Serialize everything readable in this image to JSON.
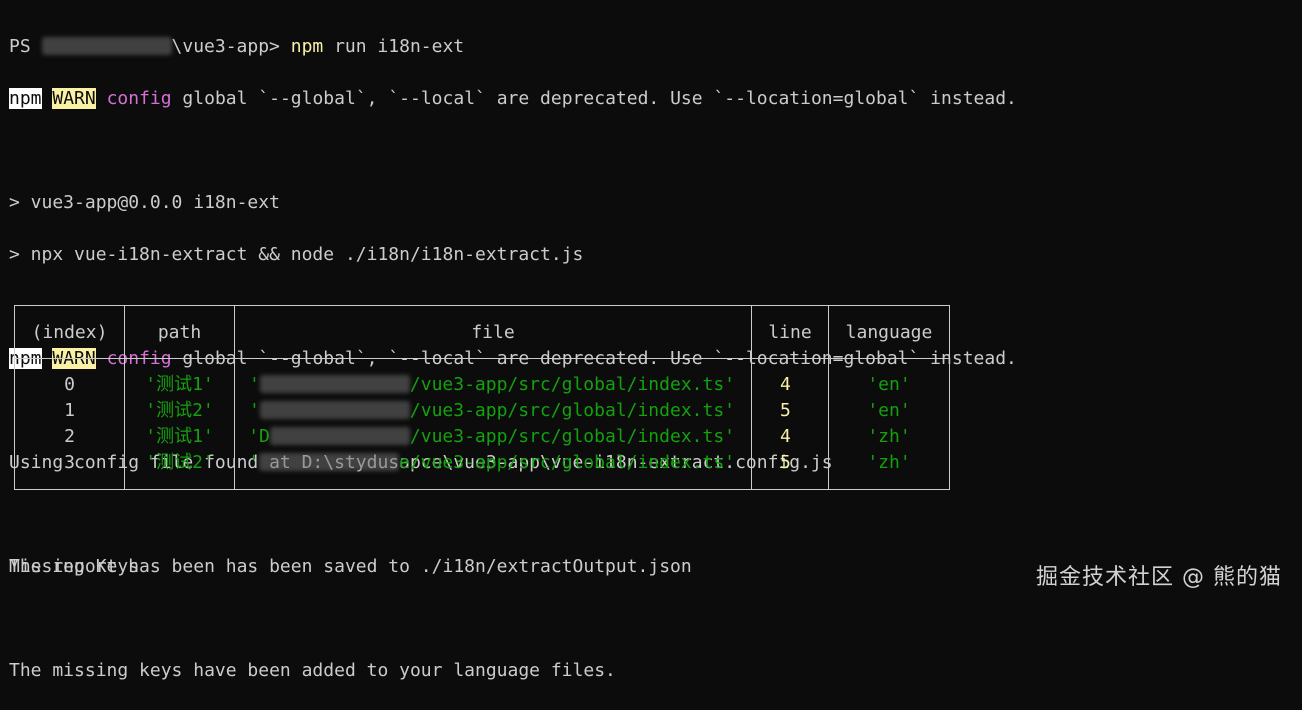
{
  "prompt": {
    "prefix": "PS ",
    "path_suffix": "\\vue3-app> ",
    "command_npm": "npm",
    "command_rest": " run i18n-ext"
  },
  "warn": {
    "npm": "npm",
    "warn": "WARN",
    "config": "config",
    "message": " global `--global`, `--local` are deprecated. Use `--location=global` instead."
  },
  "script_lines": [
    "> vue3-app@0.0.0 i18n-ext",
    "> npx vue-i18n-extract && node ./i18n/i18n-extract.js"
  ],
  "config_line": "Using config file found at D:\\stydusapce\\vue3-app\\vue-i18n-extract.config.js",
  "missing_keys_title": "Missing Keys",
  "table": {
    "headers": [
      "(index)",
      "path",
      "file",
      "line",
      "language"
    ],
    "rows": [
      {
        "index": "0",
        "path": "'测试1'",
        "file_prefix": "'",
        "file_suffix": "/vue3-app/src/global/index.ts'",
        "line": "4",
        "language": "'en'"
      },
      {
        "index": "1",
        "path": "'测试2'",
        "file_prefix": "'",
        "file_suffix": "/vue3-app/src/global/index.ts'",
        "line": "5",
        "language": "'en'"
      },
      {
        "index": "2",
        "path": "'测试1'",
        "file_prefix": "'D",
        "file_suffix": "/vue3-app/src/global/index.ts'",
        "line": "4",
        "language": "'zh'"
      },
      {
        "index": "3",
        "path": "'测试2'",
        "file_prefix": "'",
        "file_suffix": "e/vue3-app/src/global/index.ts'",
        "line": "5",
        "language": "'zh'"
      }
    ]
  },
  "report_line": "The report has been has been saved to ./i18n/extractOutput.json",
  "added_line": "The missing keys have been added to your language files.",
  "watermark": "掘金技术社区 @ 熊的猫"
}
